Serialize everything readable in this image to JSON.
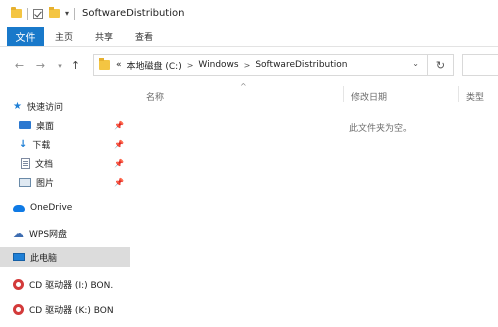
{
  "titlebar": {
    "title": "SoftwareDistribution",
    "qat_dropdown": "▾"
  },
  "ribbon": {
    "tabs": [
      "文件",
      "主页",
      "共享",
      "查看"
    ]
  },
  "nav": {
    "back": "←",
    "forward": "→",
    "recent": "▾",
    "up": "↑"
  },
  "address": {
    "prefix": "«",
    "crumbs": [
      "本地磁盘 (C:)",
      "Windows",
      "SoftwareDistribution"
    ],
    "separator": ">",
    "dropdown": "⌄",
    "refresh": "↻"
  },
  "navpane": {
    "quick_access": "快速访问",
    "quick_items": [
      {
        "label": "桌面",
        "icon": "desktop-icon"
      },
      {
        "label": "下载",
        "icon": "download-icon"
      },
      {
        "label": "文档",
        "icon": "document-icon"
      },
      {
        "label": "图片",
        "icon": "pictures-icon"
      }
    ],
    "pin_glyph": "📌",
    "onedrive": "OneDrive",
    "wps": "WPS网盘",
    "this_pc": "此电脑",
    "drives": [
      "CD 驱动器 (I:) BON.",
      "CD 驱动器 (K:) BON"
    ]
  },
  "content": {
    "sort_indicator": "^",
    "columns": [
      "名称",
      "修改日期",
      "类型"
    ],
    "empty_message": "此文件夹为空。"
  }
}
